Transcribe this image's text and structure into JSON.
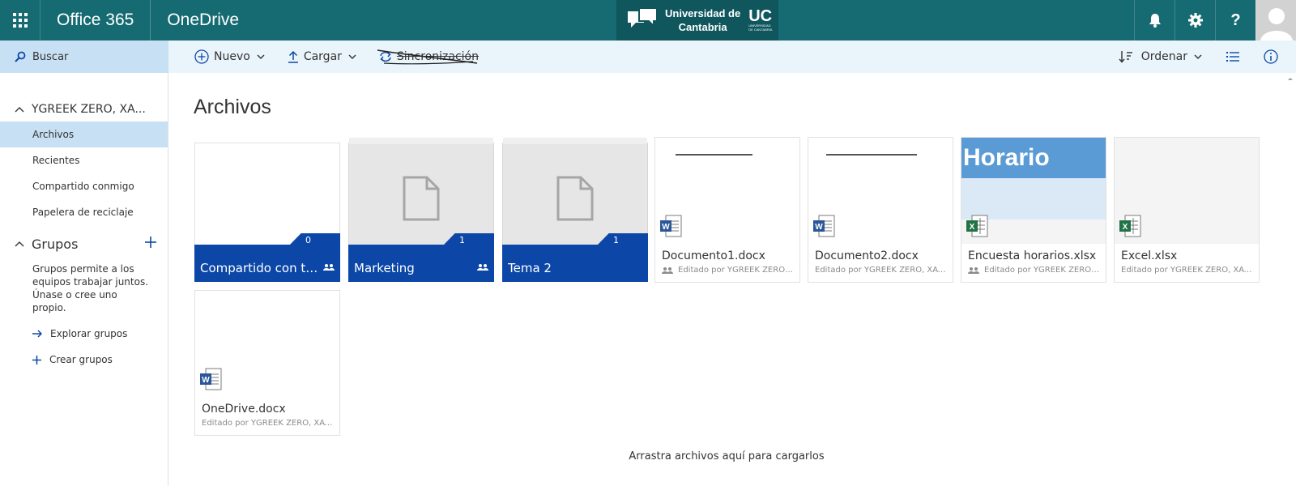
{
  "suitebar": {
    "app_suite": "Office 365",
    "app_name": "OneDrive",
    "logo": {
      "line1": "Universidad de",
      "line2": "Cantabria",
      "mark": "UC",
      "mark_small_1": "UNIVERSIDAD",
      "mark_small_2": "DE CANTABRIA"
    },
    "icons": [
      "waffle-icon",
      "bell-icon",
      "gear-icon",
      "help-icon",
      "avatar"
    ],
    "color": "#166b73"
  },
  "search": {
    "label": "Buscar"
  },
  "commands": {
    "new_label": "Nuevo",
    "upload_label": "Cargar",
    "sync_label": "Sincronización",
    "sort_label": "Ordenar"
  },
  "nav": {
    "account": "YGREEK ZERO, XA...",
    "items": [
      "Archivos",
      "Recientes",
      "Compartido conmigo",
      "Papelera de reciclaje"
    ],
    "groups_title": "Grupos",
    "groups_desc": "Grupos permite a los equipos trabajar juntos. Únase o cree uno propio.",
    "explore_groups": "Explorar grupos",
    "create_groups": "Crear grupos"
  },
  "main": {
    "title": "Archivos",
    "folders": [
      {
        "name": "Compartido con todos",
        "count": "0"
      },
      {
        "name": "Marketing",
        "count": "1"
      },
      {
        "name": "Tema 2",
        "count": "1"
      }
    ],
    "files": [
      {
        "name": "Documento1.docx",
        "meta": "Editado por YGREEK ZERO, XAVIER",
        "type": "word"
      },
      {
        "name": "Documento2.docx",
        "meta": "Editado por YGREEK ZERO, XAVIER",
        "type": "word"
      },
      {
        "name": "Encuesta horarios.xlsx",
        "meta": "Editado por YGREEK ZERO, XAVIER",
        "type": "excel",
        "thumb_title": "Horario"
      },
      {
        "name": "Excel.xlsx",
        "meta": "Editado por YGREEK ZERO, XAVIER",
        "type": "excel"
      },
      {
        "name": "OneDrive.docx",
        "meta": "Editado por YGREEK ZERO, XAVIER",
        "type": "word"
      }
    ],
    "drop_message": "Arrastra archivos aquí para cargarlos"
  },
  "colors": {
    "accent": "#0c47a8",
    "selected": "#c7e0f4",
    "commandbar": "#eaf4fb"
  }
}
